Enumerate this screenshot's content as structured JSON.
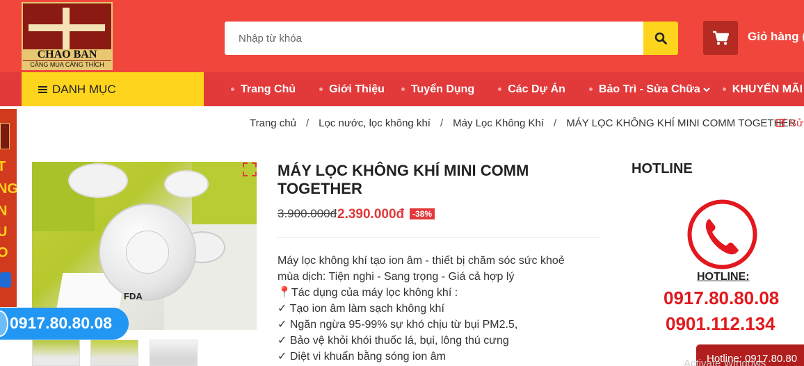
{
  "header": {
    "logo_name": "CHAO BAN",
    "logo_slogan": "CÀNG MUA CÀNG THÍCH",
    "search_placeholder": "Nhập từ khóa",
    "cart_label": "Giỏ hàng ("
  },
  "nav": {
    "menu_label": "DANH MỤC",
    "items": [
      {
        "label": "Trang Chủ"
      },
      {
        "label": "Giới Thiệu"
      },
      {
        "label": "Tuyển Dụng"
      },
      {
        "label": "Các Dự Án"
      },
      {
        "label": "Bảo Trì - Sửa Chữa"
      },
      {
        "label": "KHUYẾN MÃI"
      }
    ]
  },
  "breadcrumb": {
    "items": [
      "Trang chủ",
      "Lọc nước, lọc không khí",
      "Máy Lọc Không Khí",
      "MÁY LỌC KHÔNG KHÍ MINI COMM TOGETHER"
    ],
    "separator": "/",
    "edit_label": "Sửa"
  },
  "side_banner": {
    "letters": [
      "T",
      "NG",
      "N",
      "U",
      "O"
    ]
  },
  "floating_phone": "0917.80.80.08",
  "product": {
    "title": "MÁY LỌC KHÔNG KHÍ MINI COMM TOGETHER",
    "old_price": "3.900.000đ",
    "new_price": "2.390.000đ",
    "discount": "-38%",
    "image_label": "FDA",
    "description": [
      "Máy lọc không khí tạo ion âm - thiết bị chăm sóc sức khoẻ",
      "mùa dịch: Tiện nghi - Sang trọng - Giá cả hợp lý",
      "📍Tác dụng của máy lọc không khí :",
      "✓ Tạo ion âm làm sạch không khí",
      "✓ Ngăn ngừa 95-99% sự khó chịu từ bụi PM2.5,",
      "✓ Bảo vệ khỏi khói thuốc lá, bụi, lông thú cưng",
      "✓ Diệt vi khuẩn bằng sóng ion âm"
    ]
  },
  "hotline": {
    "title": "HOTLINE",
    "label": "HOTLINE:",
    "number1": "0917.80.80.08",
    "number2": "0901.112.134",
    "bar_text": "Hotline: 0917.80.80",
    "watermark": "Activate Windows"
  },
  "colors": {
    "header_red": "#f0463b",
    "nav_red": "#e2393a",
    "yellow": "#ffd41c",
    "price_red": "#e2393a",
    "hotline_red": "#e2181e"
  }
}
